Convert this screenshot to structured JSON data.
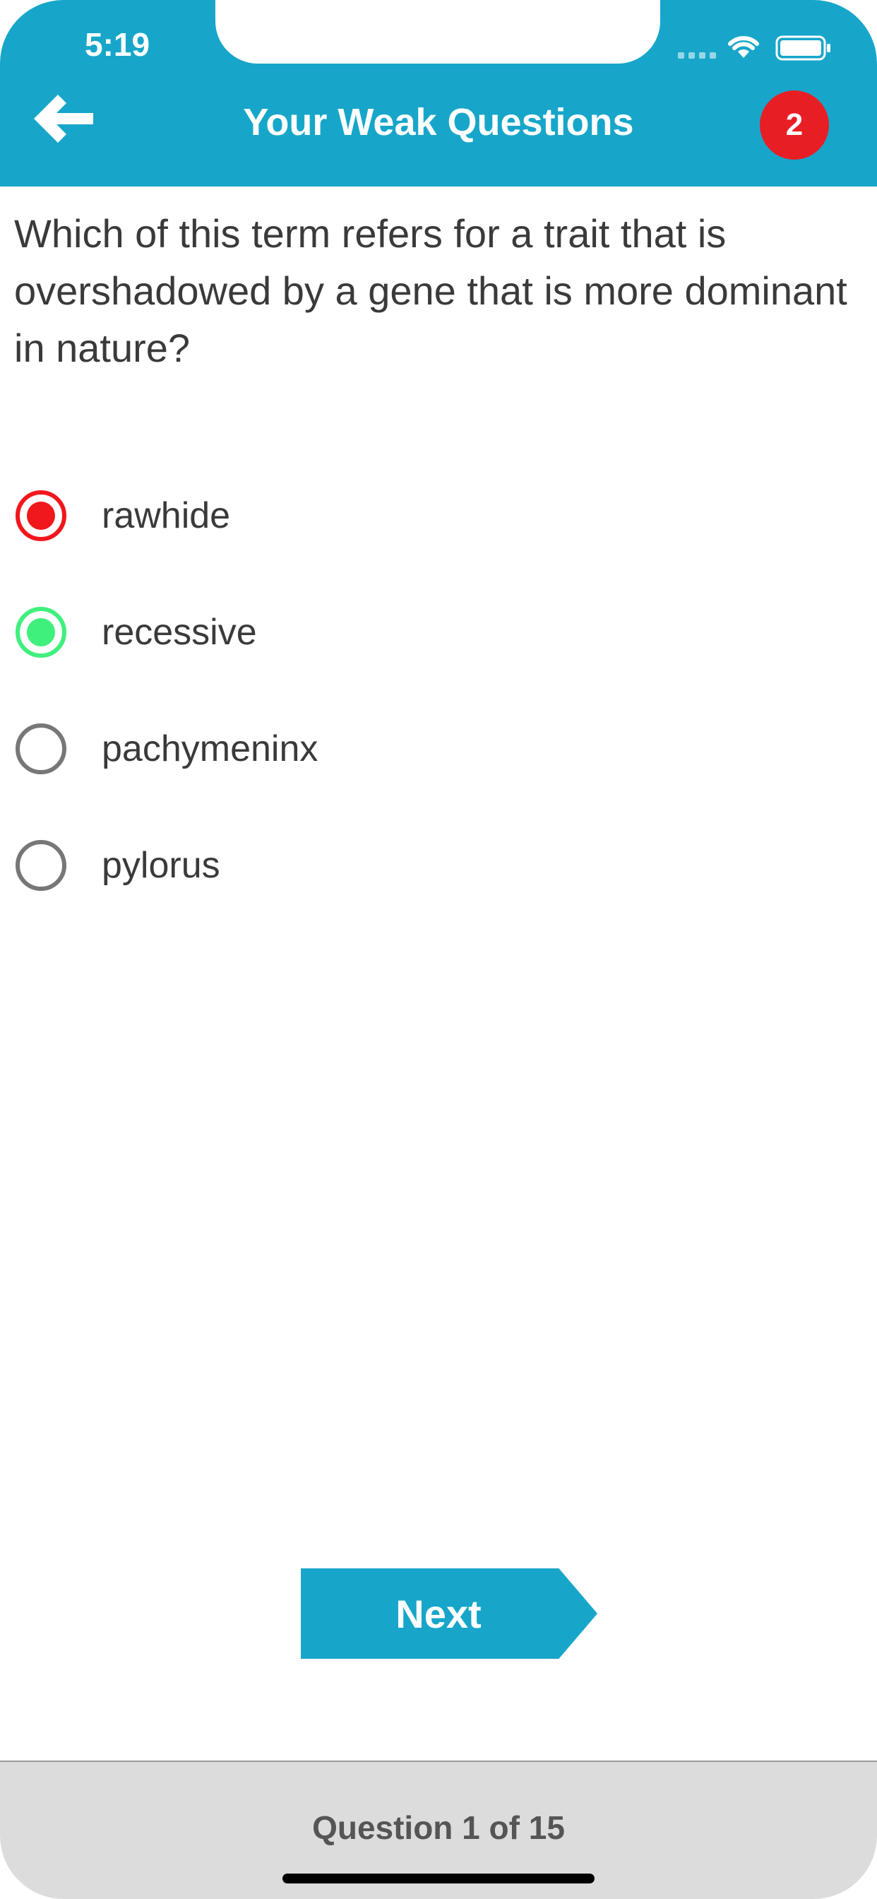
{
  "status_bar": {
    "time": "5:19"
  },
  "header": {
    "title": "Your Weak Questions",
    "badge_count": "2"
  },
  "question": {
    "text": "Which of this term refers for a trait that is overshadowed by a gene that is more dominant in nature?"
  },
  "options": [
    {
      "label": "rawhide",
      "state": "wrong"
    },
    {
      "label": "recessive",
      "state": "correct"
    },
    {
      "label": "pachymeninx",
      "state": "unselected"
    },
    {
      "label": "pylorus",
      "state": "unselected"
    }
  ],
  "next_button": {
    "label": "Next"
  },
  "footer": {
    "progress_text": "Question 1 of 15"
  },
  "colors": {
    "primary": "#17a6c9",
    "wrong": "#f0171d",
    "correct": "#3ff07d",
    "badge": "#e81e25"
  },
  "icons": {
    "back": "arrow-left-icon",
    "wifi": "wifi-icon",
    "battery": "battery-icon"
  }
}
